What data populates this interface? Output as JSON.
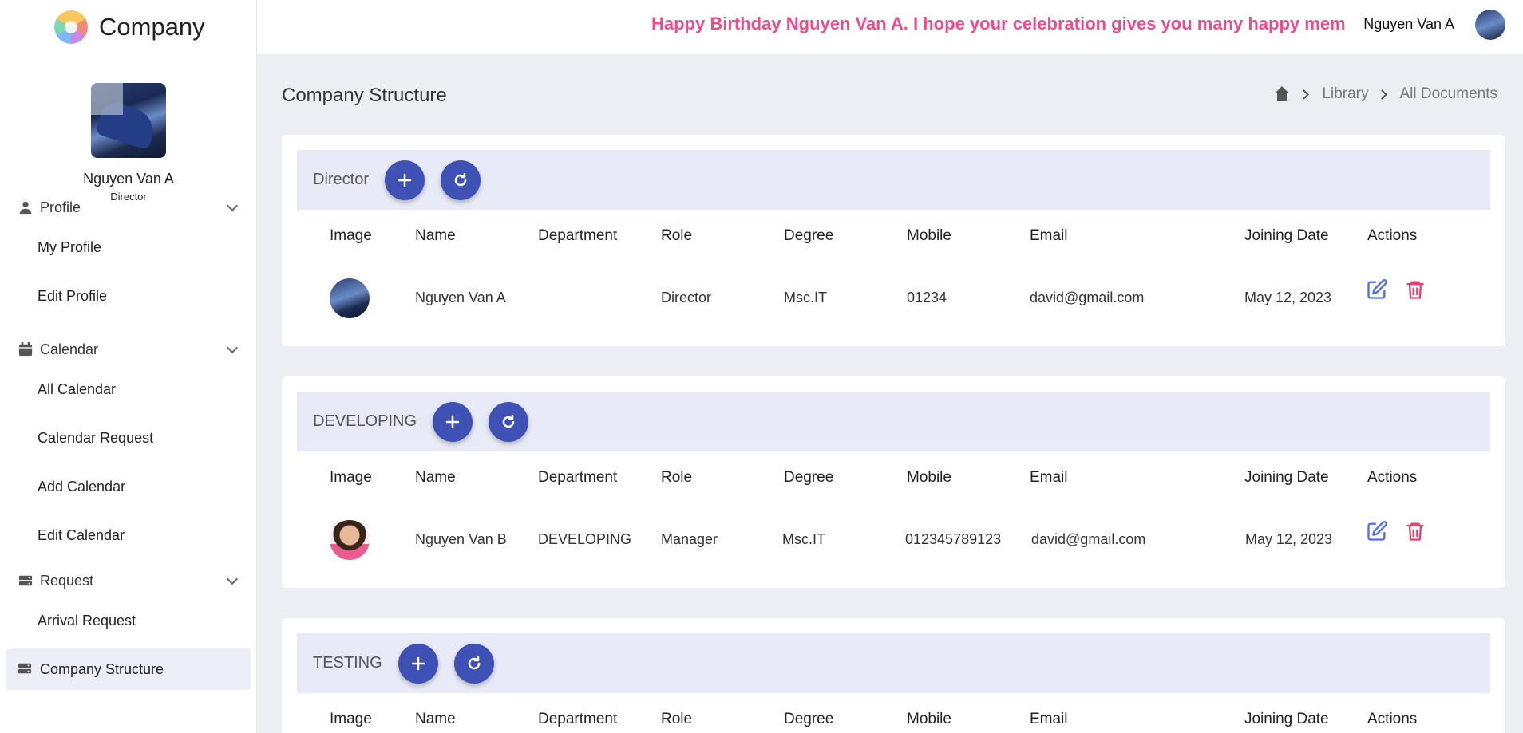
{
  "brand": {
    "name": "Company"
  },
  "sidebar": {
    "user": {
      "name": "Nguyen Van A",
      "role": "Director"
    },
    "groups": [
      {
        "label": "Profile",
        "icon": "person-icon",
        "items": [
          "My Profile",
          "Edit Profile"
        ]
      },
      {
        "label": "Calendar",
        "icon": "calendar-icon",
        "items": [
          "All Calendar",
          "Calendar Request",
          "Add Calendar",
          "Edit Calendar"
        ]
      },
      {
        "label": "Request",
        "icon": "server-icon",
        "items": [
          "Arrival Request"
        ]
      },
      {
        "label": "Company Structure",
        "icon": "server-icon",
        "active": true
      }
    ]
  },
  "header": {
    "marquee": "Happy Birthday Nguyen Van A. I hope your celebration gives you many happy memories!",
    "user_name": "Nguyen Van A"
  },
  "page": {
    "title": "Company Structure",
    "breadcrumb": [
      "Library",
      "All Documents"
    ]
  },
  "columns": [
    "Image",
    "Name",
    "Department",
    "Role",
    "Degree",
    "Mobile",
    "Email",
    "Joining Date",
    "Actions"
  ],
  "sections": [
    {
      "title": "Director",
      "rows": [
        {
          "name": "Nguyen Van A",
          "department": "",
          "role": "Director",
          "degree": "Msc.IT",
          "mobile": "01234",
          "email": "david@gmail.com",
          "joining_date": "May 12, 2023"
        }
      ]
    },
    {
      "title": "DEVELOPING",
      "rows": [
        {
          "name": "Nguyen Van B",
          "department": "DEVELOPING",
          "role": "Manager",
          "degree": "Msc.IT",
          "mobile": "012345789123",
          "email": "david@gmail.com",
          "joining_date": "May 12, 2023"
        }
      ]
    },
    {
      "title": "TESTING",
      "rows": []
    }
  ],
  "colors": {
    "accent": "#3f51b5",
    "marquee": "#ef4b8b",
    "edit": "#4f6ef7",
    "delete": "#ef3e6b"
  }
}
